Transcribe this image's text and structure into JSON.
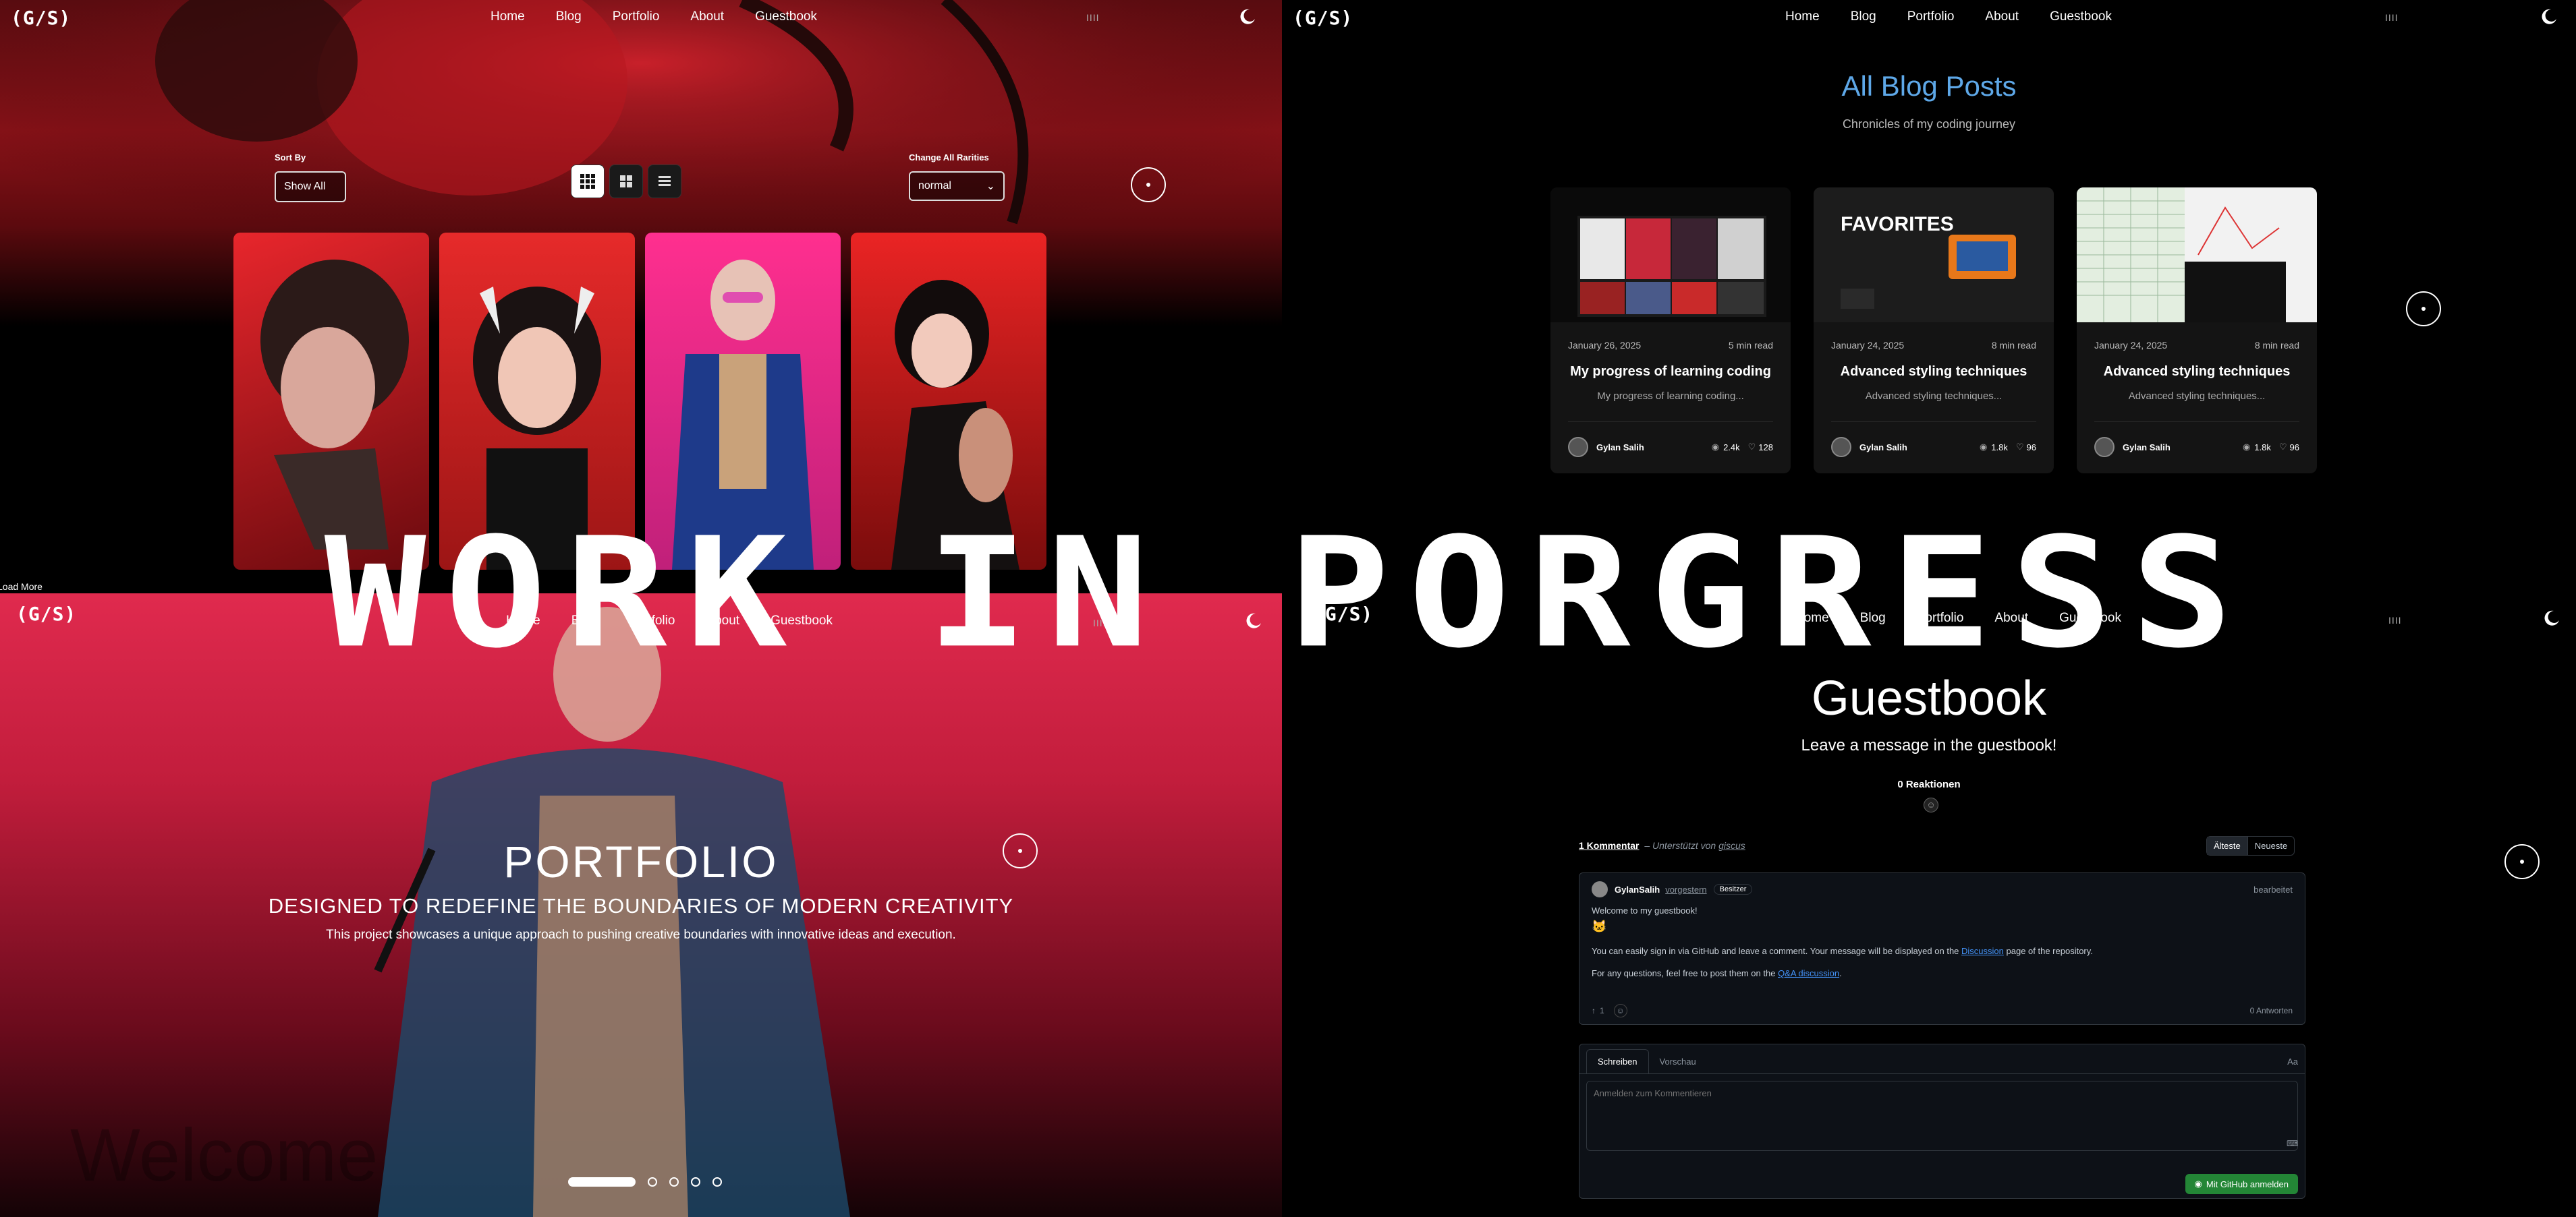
{
  "nav": {
    "logo": "(G/S)",
    "links": [
      "Home",
      "Blog",
      "Portfolio",
      "About",
      "Guestbook"
    ],
    "bars": "IIII"
  },
  "overlay": {
    "text": "WORK IN PORGRESS"
  },
  "portfolio_gallery": {
    "sort_label": "Sort By",
    "sort_value": "Show All",
    "rarity_label": "Change All Rarities",
    "rarity_value": "normal",
    "load_more": "Load More"
  },
  "blog": {
    "title": "All Blog Posts",
    "subtitle": "Chronicles of my coding journey",
    "posts": [
      {
        "date": "January 26, 2025",
        "read": "5 min read",
        "title": "My progress of learning coding",
        "excerpt": "My progress of learning coding...",
        "author": "Gylan Salih",
        "views": "2.4k",
        "likes": "128"
      },
      {
        "date": "January 24, 2025",
        "read": "8 min read",
        "title": "Advanced styling techniques",
        "excerpt": "Advanced styling techniques...",
        "author": "Gylan Salih",
        "views": "1.8k",
        "likes": "96",
        "thumb_text": "FAVORITES"
      },
      {
        "date": "January 24, 2025",
        "read": "8 min read",
        "title": "Advanced styling techniques",
        "excerpt": "Advanced styling techniques...",
        "author": "Gylan Salih",
        "views": "1.8k",
        "likes": "96"
      }
    ]
  },
  "hero": {
    "title": "PORTFOLIO",
    "tagline": "DESIGNED TO REDEFINE THE BOUNDARIES OF MODERN CREATIVITY",
    "description": "This project showcases a unique approach to pushing creative boundaries with innovative ideas and execution.",
    "watermark": "Welcome"
  },
  "guestbook": {
    "title": "Guestbook",
    "subtitle": "Leave a message in the guestbook!",
    "reactions": "0 Reaktionen",
    "comment_count": "1 Kommentar",
    "powered_prefix": "– Unterstützt von",
    "powered_link": "giscus",
    "sort_oldest": "Älteste",
    "sort_newest": "Neueste",
    "comment": {
      "author": "GylanSalih",
      "time": "vorgestern",
      "badge": "Besitzer",
      "edited": "bearbeitet",
      "line1": "Welcome to my guestbook!",
      "line2_pre": "You can easily sign in via GitHub and leave a comment. Your message will be displayed on the",
      "line2_link": "Discussion",
      "line2_post": "page of the repository.",
      "line3_pre": "For any questions, feel free to post them on the",
      "line3_link": "Q&A discussion",
      "line3_post": ".",
      "upvotes": "1",
      "replies": "0 Antworten"
    },
    "tab_write": "Schreiben",
    "tab_preview": "Vorschau",
    "aa": "Aa",
    "placeholder": "Anmelden zum Kommentieren",
    "signin": "Mit GitHub anmelden"
  },
  "colors": {
    "blog_title": "#5ea8e8",
    "hero_bg": "#e02a4e",
    "github_green": "#238636",
    "link": "#4493f8"
  }
}
